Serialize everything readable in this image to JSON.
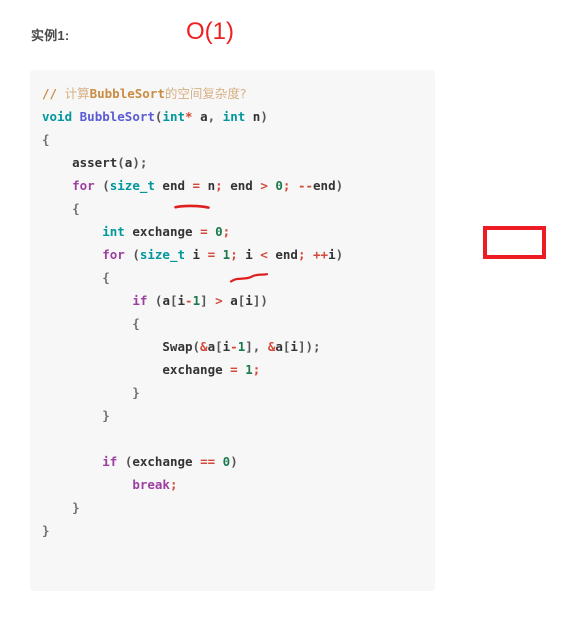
{
  "header": {
    "example_label": "实例1:",
    "complexity_value": "O(1)",
    "complexity_color": "#ef2020"
  },
  "code_block": {
    "language": "c",
    "background_color": "#f7f7f7",
    "lines": [
      {
        "id": 1,
        "text": "// 计算BubbleSort的空间复杂度?"
      },
      {
        "id": 2,
        "text": "void BubbleSort(int* a, int n)"
      },
      {
        "id": 3,
        "text": "{"
      },
      {
        "id": 4,
        "text": "    assert(a);"
      },
      {
        "id": 5,
        "text": "    for (size_t end = n; end > 0; --end)"
      },
      {
        "id": 6,
        "text": "    {"
      },
      {
        "id": 7,
        "text": "        int exchange = 0;"
      },
      {
        "id": 8,
        "text": "        for (size_t i = 1; i < end; ++i)"
      },
      {
        "id": 9,
        "text": "        {"
      },
      {
        "id": 10,
        "text": "            if (a[i-1] > a[i])"
      },
      {
        "id": 11,
        "text": "            {"
      },
      {
        "id": 12,
        "text": "                Swap(&a[i-1], &a[i]);"
      },
      {
        "id": 13,
        "text": "                exchange = 1;"
      },
      {
        "id": 14,
        "text": "            }"
      },
      {
        "id": 15,
        "text": "        }"
      },
      {
        "id": 16,
        "text": ""
      },
      {
        "id": 17,
        "text": "        if (exchange == 0)"
      },
      {
        "id": 18,
        "text": "            break;"
      },
      {
        "id": 19,
        "text": "    }"
      },
      {
        "id": 20,
        "text": "}"
      }
    ]
  },
  "annotations": {
    "color": "#e02020",
    "marks": [
      {
        "name": "underline-under-end",
        "shape": "straight-underline",
        "target_token": "end"
      },
      {
        "name": "squiggle-under-size_t",
        "shape": "wavy-underline",
        "target_token": "size_t"
      }
    ]
  },
  "red_box": {
    "label": "",
    "border_color": "#ed1c24",
    "fill_color": "#ffffff"
  }
}
